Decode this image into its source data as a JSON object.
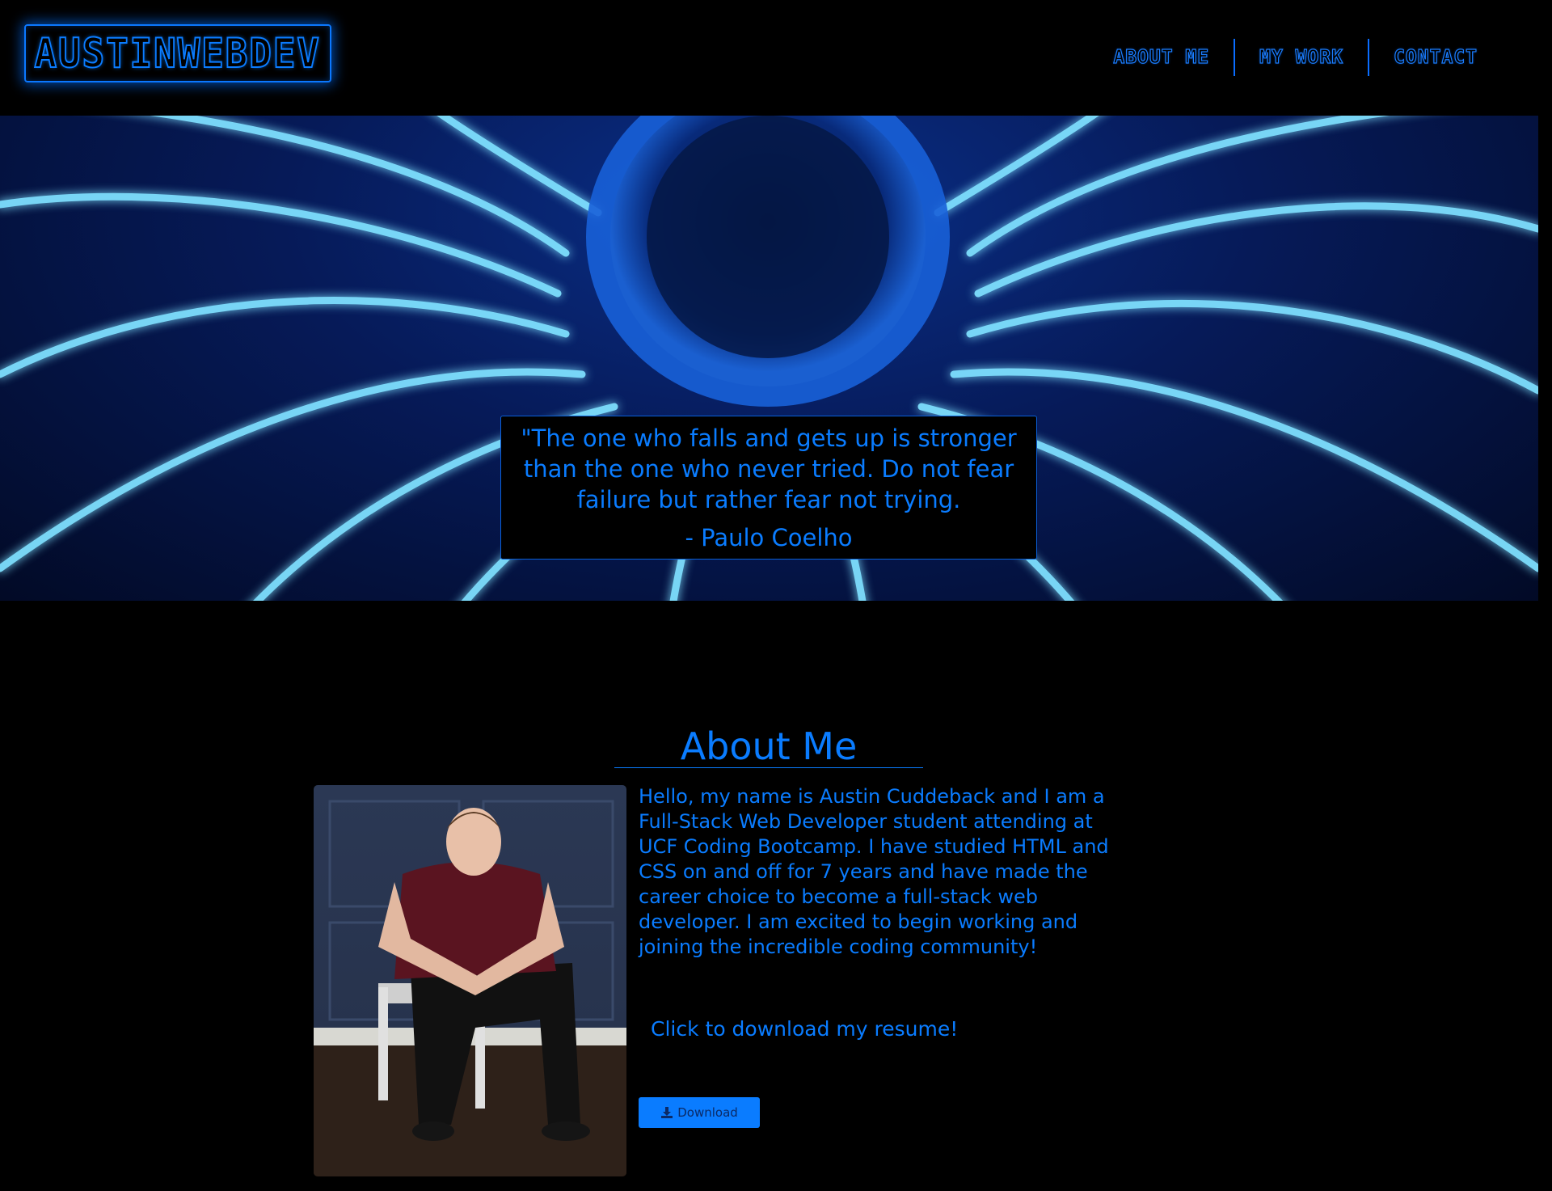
{
  "header": {
    "logo_text": "AUSTINWEBDEV",
    "nav": [
      {
        "label": "ABOUT ME"
      },
      {
        "label": "MY WORK"
      },
      {
        "label": "CONTACT"
      }
    ]
  },
  "hero": {
    "quote": "\"The one who falls and gets up is stronger than the one who never tried. Do not fear failure but rather fear not trying.",
    "author": "- Paulo Coelho"
  },
  "about": {
    "title": "About Me",
    "bio": "Hello, my name is Austin Cuddeback and I am a Full-Stack Web Developer student attending at UCF Coding Bootcamp. I have studied HTML and CSS on and off for 7 years and have made the career choice to become a full-stack web developer. I am excited to begin working and joining the incredible coding community!",
    "resume_prompt": "Click to download my resume!",
    "download_label": "Download",
    "download_icon": "download-icon"
  },
  "colors": {
    "accent": "#0a7cff",
    "background": "#000000"
  }
}
